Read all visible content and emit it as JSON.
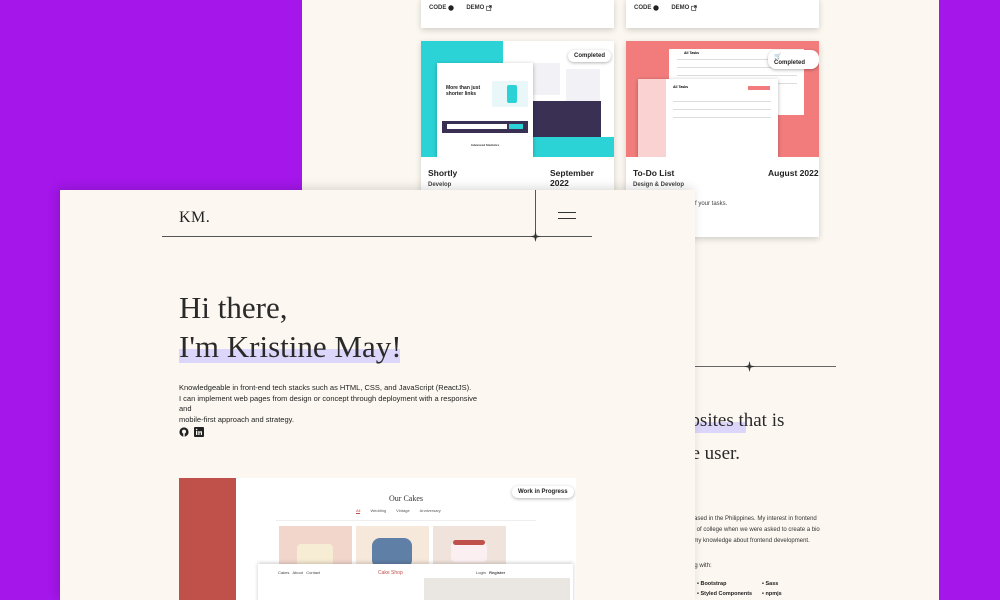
{
  "colors": {
    "background": "#a416ea",
    "page": "#fcf8f1",
    "highlight": "#dcd6fb",
    "accent_red": "#c0504a",
    "shortly_teal": "#2bd3d6",
    "todo_coral": "#f27c7c"
  },
  "top_cards": [
    {
      "code_label": "CODE",
      "demo_label": "DEMO"
    },
    {
      "code_label": "CODE",
      "demo_label": "DEMO"
    }
  ],
  "projects": [
    {
      "title": "Shortly",
      "date": "September 2022",
      "role": "Develop",
      "status": "Completed",
      "preview_heading": "More than just shorter links",
      "preview_sub": "Advanced Statistics"
    },
    {
      "title": "To-Do List",
      "date": "August 2022",
      "role": "Design & Develop",
      "status": "Completed",
      "description_fragment": "ck of your tasks.",
      "preview_heading_a": "All Tasks",
      "preview_heading_b": "All Tasks"
    }
  ],
  "nav": {
    "logo": "KM."
  },
  "hero": {
    "line1": "Hi there,",
    "line2": "I'm Kristine May!",
    "bio": [
      "Knowledgeable in front-end tech stacks such as HTML, CSS, and JavaScript (ReactJS).",
      "I can implement web pages from design or concept through deployment with a responsive and",
      "mobile-first approach and strategy."
    ],
    "icons": [
      "github-icon",
      "linkedin-icon"
    ]
  },
  "featured_project": {
    "status": "Work in Progress",
    "site_title": "Our Cakes",
    "tabs": [
      "All",
      "Wedding",
      "Vintage",
      "Anniversary"
    ],
    "sub_nav": [
      "Cakes",
      "About",
      "Contact"
    ],
    "sub_logo": "Cake Shop",
    "sub_actions": [
      "Login",
      "Register"
    ]
  },
  "about": {
    "heading_line1": "ebsites that is",
    "heading_line2": "ne user.",
    "text_lines": [
      "oper based in the Philippines. My interest in frontend",
      "st year of college when we were asked to create a bio",
      "nding my knowledge about frontend development."
    ],
    "working_with": "working with:",
    "skills_col1": [
      "Bootstrap",
      "Styled Components"
    ],
    "skills_col2": [
      "Sass",
      "npmjs"
    ]
  }
}
